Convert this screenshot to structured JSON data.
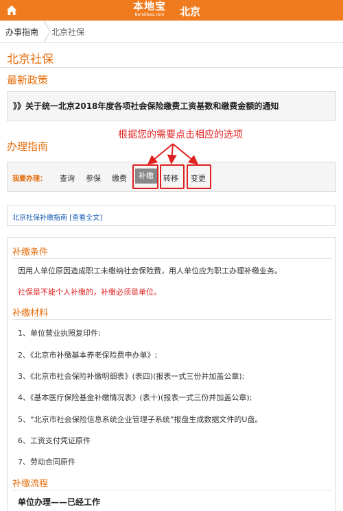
{
  "header": {
    "logo_text": "本地宝",
    "logo_sub": "Bendibao.com",
    "city": "北京",
    "home_icon": "home-icon",
    "bg_color": "#f07b1f"
  },
  "breadcrumb": {
    "item1": "办事指南",
    "item2": "北京社保"
  },
  "page_title": "北京社保",
  "latest_policy": {
    "heading": "最新政策",
    "item": "》》关于统一北京2018年度各项社会保险缴费工资基数和缴费金额的通知"
  },
  "guide": {
    "heading": "办理指南",
    "annotation": "根据您的需要点击相应的选项",
    "handle_label": "我要办理：",
    "options": [
      "查询",
      "参保",
      "缴费",
      "补缴",
      "转移",
      "变更"
    ],
    "active_option": "补缴",
    "guide_link": "北京社保补缴指南",
    "full_text_link": "[查看全文]"
  },
  "conditions": {
    "heading": "补缴条件",
    "text": "因用人单位原因造成职工未缴纳社会保险费，用人单位应为职工办理补缴业务。",
    "warning": "社保是不能个人补缴的，补缴必须是单位。"
  },
  "materials": {
    "heading": "补缴材料",
    "items": [
      "1、单位营业执照复印件;",
      "2、《北京市补缴基本养老保险费申办单》;",
      "3、《北京市社会保险补缴明细表》(表四)(报表一式三份并加盖公章);",
      "4、《基本医疗保险基金补缴情况表》(表十)(报表一式三份并加盖公章);",
      "5、“北京市社会保险信息系统企业管理子系统”报盘生成数据文件的U盘。",
      "6、工资支付凭证原件",
      "7、劳动合同原件"
    ]
  },
  "process": {
    "heading": "补缴流程",
    "sub": "单位办理——已经工作"
  },
  "colors": {
    "accent": "#e46c0a",
    "annotation_red": "#e02020",
    "link_blue": "#1a5fb4"
  }
}
